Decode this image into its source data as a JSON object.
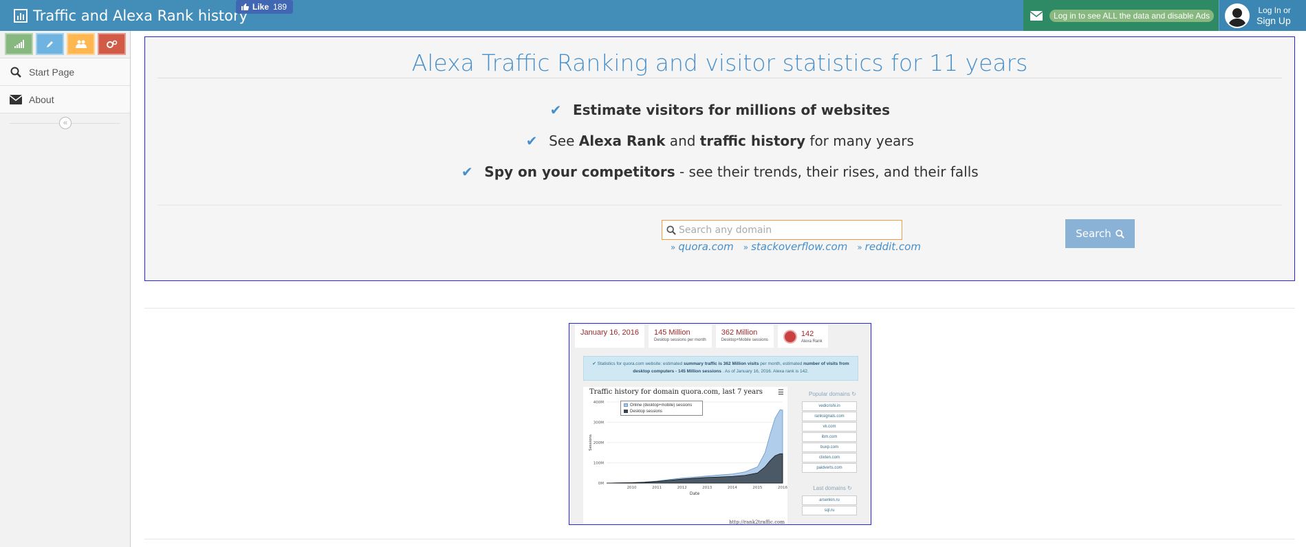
{
  "header": {
    "brand_title": "Traffic and Alexa Rank history",
    "fb_like_label": "Like",
    "fb_like_count": "189",
    "login_notice": "Log in to see ALL the data and disable Ads",
    "login_label": "Log In or",
    "signup_label": "Sign Up",
    "colors": {
      "bar": "#438eb9",
      "login_bg": "#2e8965",
      "pill": "#87b87f"
    }
  },
  "sidebar": {
    "shortcuts": [
      {
        "icon": "signal-icon",
        "color": "#87b87f"
      },
      {
        "icon": "pencil-icon",
        "color": "#6fb3e0"
      },
      {
        "icon": "users-icon",
        "color": "#ffb752"
      },
      {
        "icon": "cogs-icon",
        "color": "#d15b47"
      }
    ],
    "items": [
      {
        "label": "Start Page",
        "icon": "search-icon"
      },
      {
        "label": "About",
        "icon": "envelope-icon"
      }
    ],
    "collapse_glyph": "«"
  },
  "hero": {
    "title": "Alexa Traffic Ranking and visitor statistics for 11 years",
    "feature1": {
      "bold": "Estimate visitors for millions of websites"
    },
    "feature2": {
      "pre": "See ",
      "bold1": "Alexa Rank",
      "mid": " and ",
      "bold2": "traffic history",
      "post": " for many years"
    },
    "feature3": {
      "bold": "Spy on your competitors",
      "post": " - see their trends, their rises, and their falls"
    },
    "search_placeholder": "Search any domain",
    "search_button": "Search",
    "examples": [
      "quora.com",
      "stackoverflow.com",
      "reddit.com"
    ]
  },
  "preview": {
    "stats": [
      {
        "value": "January 16, 2016",
        "label": ""
      },
      {
        "value": "145 Million",
        "label": "Desktop sessions per month"
      },
      {
        "value": "362 Million",
        "label": "Desktop+Mobile sessions"
      },
      {
        "value": "142",
        "label": "Alexa Rank"
      }
    ],
    "info_text": {
      "a": "Statistics for quora.com website: estimated ",
      "b": "summary traffic is 362 Million visits",
      "c": " per month, estimated ",
      "d": "number of visits from desktop computers - 145 Million sessions",
      "e": " . As of January 16, 2016. Alexa rank is 142."
    },
    "popular_head": "Popular domains",
    "popular": [
      "vedicrishi.in",
      "ranksignals.com",
      "vk.com",
      "ibm.com",
      "buxp.com",
      "clixten.com",
      "paidverts.com"
    ],
    "last_head": "Last domains",
    "last": [
      "arsenkin.ru",
      "sql.ru"
    ]
  },
  "chart_data": {
    "type": "area",
    "title": "Traffic history for domain quora.com, last 7 years",
    "xlabel": "Date",
    "ylabel": "Sessions",
    "x_ticks": [
      "2010",
      "2011",
      "2012",
      "2013",
      "2014",
      "2015",
      "2016"
    ],
    "y_ticks": [
      "0M",
      "100M",
      "200M",
      "300M",
      "400M"
    ],
    "ylim": [
      0,
      400
    ],
    "x": [
      2009.0,
      2009.5,
      2010.0,
      2010.5,
      2011.0,
      2011.5,
      2012.0,
      2012.5,
      2013.0,
      2013.5,
      2014.0,
      2014.5,
      2015.0,
      2015.3,
      2015.5,
      2015.7,
      2015.9,
      2016.0
    ],
    "series": [
      {
        "name": "Online (desktop+mobile) sessions",
        "color": "#a9c8ea",
        "values": [
          0,
          1,
          2,
          5,
          10,
          18,
          25,
          30,
          35,
          40,
          45,
          55,
          80,
          150,
          240,
          320,
          362,
          360
        ]
      },
      {
        "name": "Desktop sessions",
        "color": "#39434f",
        "values": [
          0,
          1,
          2,
          4,
          8,
          14,
          20,
          24,
          28,
          30,
          33,
          38,
          50,
          80,
          110,
          135,
          145,
          145
        ]
      }
    ],
    "legend": "top-left",
    "credit": "http://rank2traffic.com"
  }
}
